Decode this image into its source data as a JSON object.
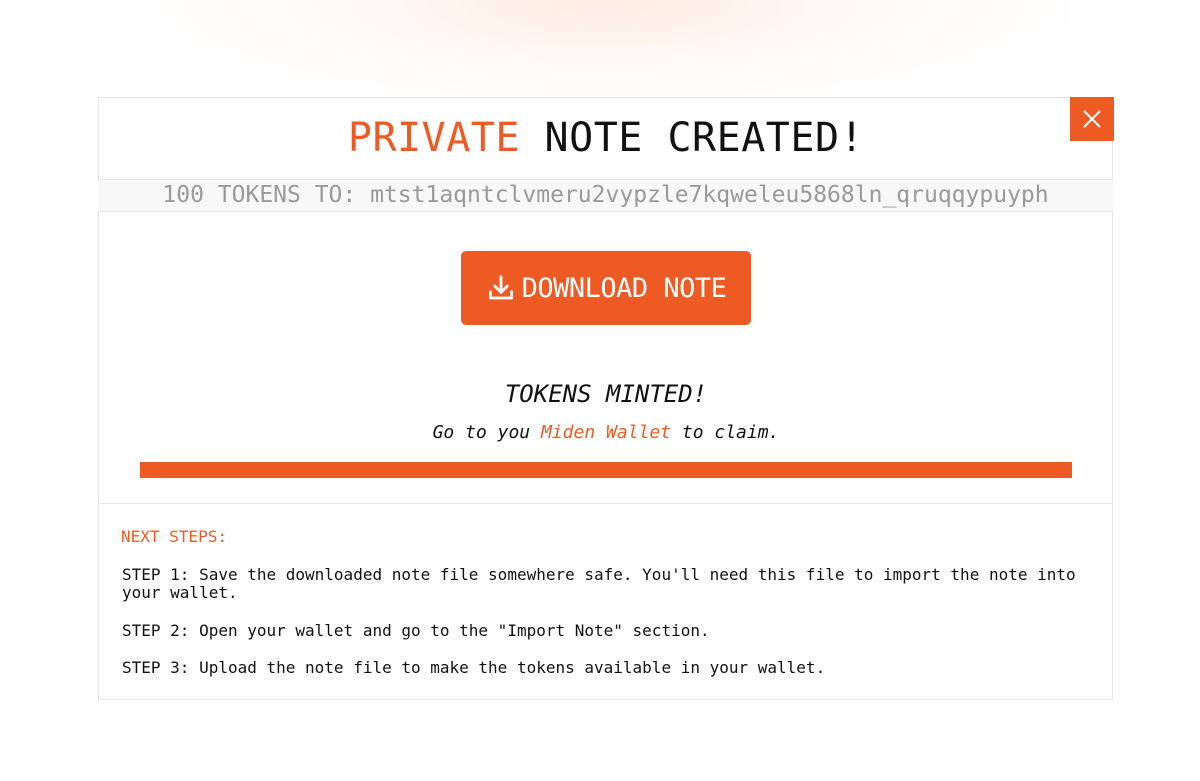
{
  "colors": {
    "accent": "#EE5A24",
    "text": "#111111",
    "muted": "#9a9a9a"
  },
  "close_button": {
    "icon": "close-icon"
  },
  "title": {
    "accent_word": "PRIVATE",
    "rest": " NOTE CREATED!"
  },
  "recipient": {
    "text": "100 TOKENS TO: mtst1aqntclvmeru2vypzle7kqweleu5868ln_qruqqypuyph"
  },
  "download_button": {
    "icon": "download-icon",
    "label": "DOWNLOAD NOTE"
  },
  "status": {
    "title": "TOKENS MINTED!",
    "claim_prefix": "Go to you ",
    "claim_link": "Miden Wallet",
    "claim_suffix": " to claim.",
    "progress": 1.0
  },
  "next_steps": {
    "title": "NEXT STEPS:",
    "steps": [
      "STEP 1: Save the downloaded note file somewhere safe. You'll need this file to import the note into your wallet.",
      "STEP 2: Open your wallet and go to the \"Import Note\" section.",
      "STEP 3: Upload the note file to make the tokens available in your wallet."
    ]
  }
}
